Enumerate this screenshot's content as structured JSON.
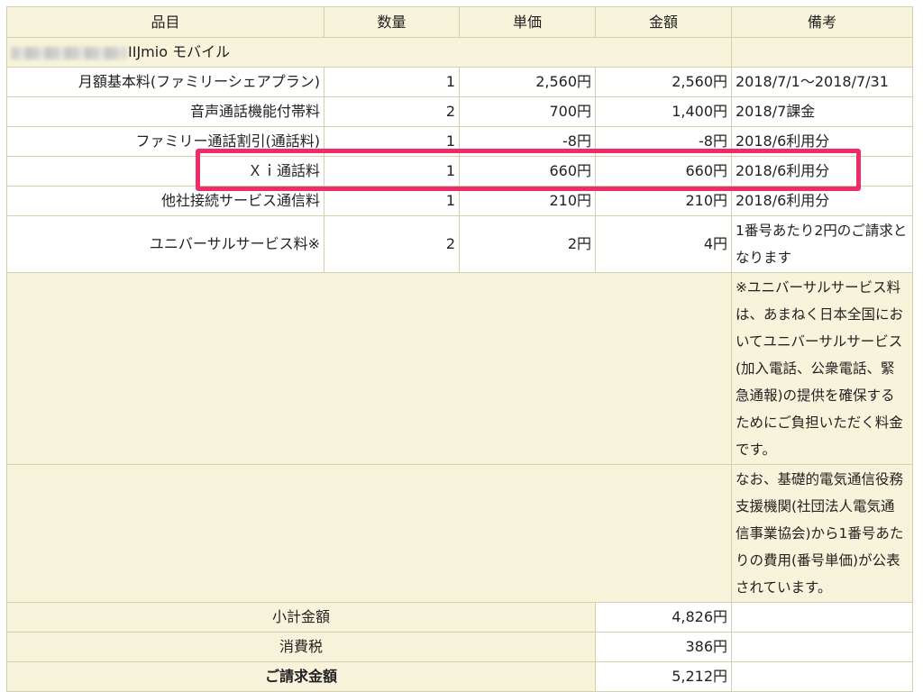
{
  "headers": {
    "item": "品目",
    "qty": "数量",
    "unit_price": "単価",
    "amount": "金額",
    "note": "備考"
  },
  "service_title": "IIJmio モバイル",
  "rows": [
    {
      "item": "月額基本料(ファミリーシェアプラン)",
      "qty": "1",
      "unit_price": "2,560円",
      "amount": "2,560円",
      "note": "2018/7/1〜2018/7/31"
    },
    {
      "item": "音声通話機能付帯料",
      "qty": "2",
      "unit_price": "700円",
      "amount": "1,400円",
      "note": "2018/7課金"
    },
    {
      "item": "ファミリー通話割引(通話料)",
      "qty": "1",
      "unit_price": "-8円",
      "amount": "-8円",
      "note": "2018/6利用分"
    },
    {
      "item": "Ｘｉ通話料",
      "qty": "1",
      "unit_price": "660円",
      "amount": "660円",
      "note": "2018/6利用分"
    },
    {
      "item": "他社接続サービス通信料",
      "qty": "1",
      "unit_price": "210円",
      "amount": "210円",
      "note": "2018/6利用分"
    },
    {
      "item": "ユニバーサルサービス料※",
      "qty": "2",
      "unit_price": "2円",
      "amount": "4円",
      "note": "1番号あたり2円のご請求となります"
    }
  ],
  "notes": {
    "universal_service": "※ユニバーサルサービス料は、あまねく日本全国においてユニバーサルサービス(加入電話、公衆電話、緊急通報)の提供を確保するためにご負担いただく料金です。",
    "support_org": "なお、基礎的電気通信役務支援機関(社団法人電気通信事業協会)から1番号あたりの費用(番号単価)が公表されています。"
  },
  "summary": {
    "subtotal_label": "小計金額",
    "subtotal_value": "4,826円",
    "tax_label": "消費税",
    "tax_value": "386円",
    "total_label": "ご請求金額",
    "total_value": "5,212円"
  },
  "colors": {
    "highlight": "#ee2c68",
    "row_shade": "#f8f4db",
    "border": "#d4cfae"
  }
}
